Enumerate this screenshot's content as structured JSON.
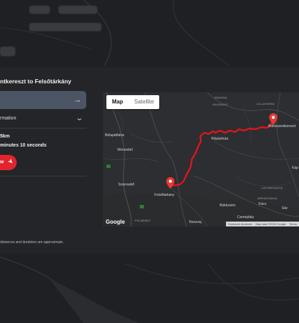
{
  "background": {
    "chips": [
      "",
      "",
      "",
      ""
    ]
  },
  "panel": {
    "title": "ntkereszt to Felsőtárkány",
    "start_value": "",
    "start_arrow_icon": "arrow-right-icon",
    "info_label": "rmation",
    "info_chevron_icon": "chevron-down-icon",
    "distance": "5km",
    "duration": "minutes 10 seconds",
    "view_button_label": "w",
    "view_button_icon": "navigation-arrow-icon",
    "footnote": "distances and durations are approximate."
  },
  "map": {
    "toggle": {
      "map": "Map",
      "satellite": "Satellite",
      "selected": "Map"
    },
    "labels": {
      "bukkszentkereszt": "Bükkszentkereszt",
      "belapatfalva": "Bélapátfalva",
      "monosbel": "Monosbél",
      "szarvasko": "Szarvaskő",
      "felsotarkany": "Felsőtárkány",
      "bukkzserc": "Bükkzsérc",
      "csereptalu": "Cserépfalu",
      "noszvaj": "Noszvaj",
      "kacs": "Kács",
      "sav": "Sáv",
      "kap": "Káp",
      "omassa": "ÓMASSA",
      "javorkut": "JÁVORKÚT",
      "lillafured": "LILLAFÜRED",
      "repashuta": "Répáshuta",
      "latorpuszta": "LATORPUSZTA",
      "arpadtanya": "ÁRPÁDTANYA",
      "felnemet": "FELNÉMET"
    },
    "google_logo": "Google",
    "footer": {
      "shortcuts": "Keyboard shortcuts",
      "data": "Map data ©2025 Google",
      "terms": "Terms"
    },
    "route_color": "#e0151d",
    "pin_color": "#e53935"
  }
}
